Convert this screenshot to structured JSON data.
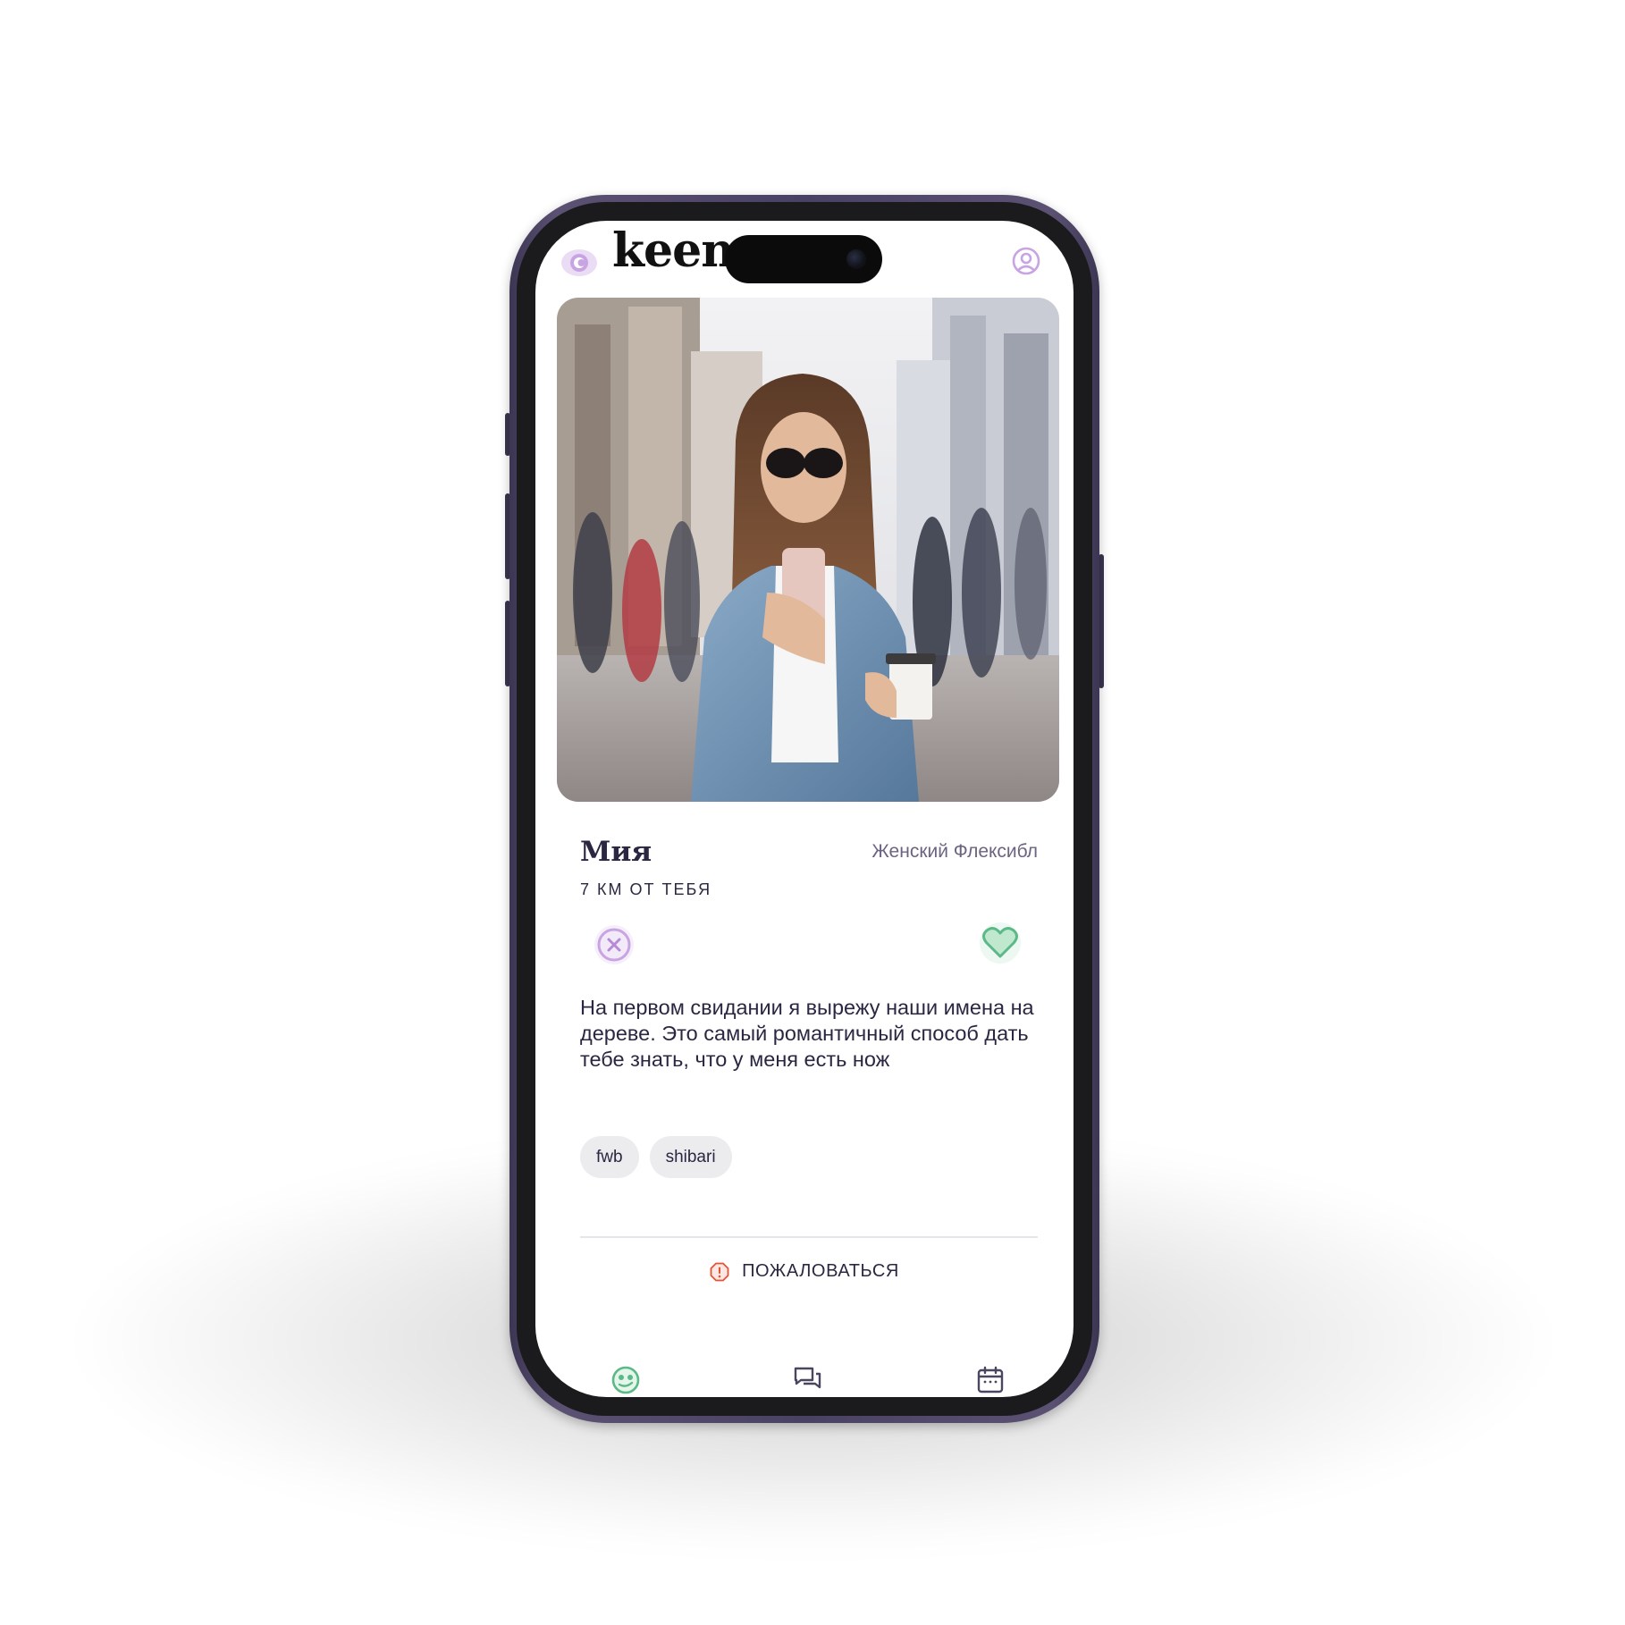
{
  "app": {
    "brand": "keenq",
    "accent_color": "#c9a4e3",
    "like_color": "#5bb987",
    "report_color": "#e2543a"
  },
  "header": {
    "logo_icon": "eye-icon",
    "profile_icon": "user-circle-icon"
  },
  "profile": {
    "name": "Мия",
    "orientation": "Женский Флексибл",
    "distance": "7 КМ ОТ ТЕБЯ",
    "bio": "На первом свидании я вырежу наши имена на дереве. Это самый романтичный способ дать тебе знать, что у меня есть нож",
    "tags": [
      "fwb",
      "shibari"
    ]
  },
  "actions": {
    "dislike_icon": "close-circle-icon",
    "like_icon": "heart-icon"
  },
  "report": {
    "label": "ПОЖАЛОВАТЬСЯ",
    "icon": "alert-octagon-icon"
  },
  "tabbar": {
    "items": [
      {
        "icon": "match-face-icon",
        "active": true
      },
      {
        "icon": "chat-bubbles-icon",
        "active": false
      },
      {
        "icon": "calendar-icon",
        "active": false
      }
    ]
  }
}
